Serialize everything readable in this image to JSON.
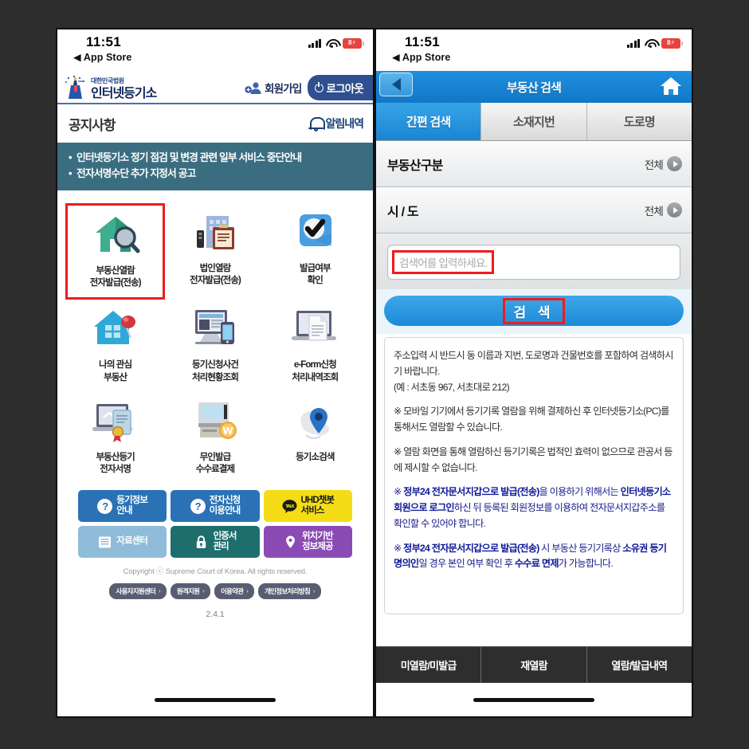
{
  "left_phone": {
    "status_bar": {
      "time": "11:51",
      "back_app": "App Store",
      "battery": "8"
    },
    "header": {
      "logo_small": "대한민국법원",
      "logo_big": "인터넷등기소",
      "join_label": "회원가입",
      "logout_label": "로그아웃"
    },
    "notice": {
      "title": "공지사항",
      "alarm_label": "알림내역",
      "items": [
        "인터넷등기소 정기 점검 및 변경 관련 일부 서비스 중단안내",
        "전자서명수단 추가 지정서 공고"
      ]
    },
    "menu_grid": [
      {
        "line1": "부동산열람",
        "line2": "전자발급(전송)",
        "icon": "house-magnifier-icon",
        "highlighted": true
      },
      {
        "line1": "법인열람",
        "line2": "전자발급(전송)",
        "icon": "building-clipboard-icon",
        "highlighted": false
      },
      {
        "line1": "발급여부",
        "line2": "확인",
        "icon": "checkmark-icon",
        "highlighted": false
      },
      {
        "line1": "나의 관심",
        "line2": "부동산",
        "icon": "house-pin-icon",
        "highlighted": false
      },
      {
        "line1": "등기신청사건",
        "line2": "처리현황조회",
        "icon": "monitor-mobile-icon",
        "highlighted": false
      },
      {
        "line1": "e-Form신청",
        "line2": "처리내역조회",
        "icon": "laptop-document-icon",
        "highlighted": false
      },
      {
        "line1": "부동산등기",
        "line2": "전자서명",
        "icon": "laptop-certificate-icon",
        "highlighted": false
      },
      {
        "line1": "무인발급",
        "line2": "수수료결제",
        "icon": "kiosk-won-icon",
        "highlighted": false
      },
      {
        "line1": "등기소검색",
        "line2": "",
        "icon": "map-pin-icon",
        "highlighted": false
      }
    ],
    "quick_buttons": [
      {
        "line1": "등기정보",
        "line2": "안내",
        "icon": "question-circle-icon",
        "color": "#2a72b5"
      },
      {
        "line1": "전자신청",
        "line2": "이용안내",
        "icon": "question-circle-icon",
        "color": "#2a72b5"
      },
      {
        "line1": "UHD챗봇",
        "line2": "서비스",
        "icon": "talk-bubble-icon",
        "color": "#f4dd16",
        "text_color": "#1a1a1a"
      },
      {
        "line1": "자료센터",
        "line2": "",
        "icon": "list-icon",
        "color": "#8fbcd8"
      },
      {
        "line1": "인증서",
        "line2": "관리",
        "icon": "lock-icon",
        "color": "#1e6e6e"
      },
      {
        "line1": "위치기반",
        "line2": "정보제공",
        "icon": "map-pin-icon",
        "color": "#8a4bb5"
      }
    ],
    "footer": {
      "copyright": "Copyright ⓒ Supreme Court of Korea. All rights reserved.",
      "links": [
        "사용자지원센터",
        "원격지원",
        "이용약관",
        "개인정보처리방침"
      ],
      "version": "2.4.1"
    }
  },
  "right_phone": {
    "status_bar": {
      "time": "11:51",
      "back_app": "App Store",
      "battery": "8"
    },
    "title_bar": {
      "title": "부동산 검색",
      "back_icon": "back-arrow-icon",
      "home_icon": "home-icon"
    },
    "tabs": [
      {
        "label": "간편 검색",
        "active": true
      },
      {
        "label": "소재지번",
        "active": false
      },
      {
        "label": "도로명",
        "active": false
      }
    ],
    "rows": [
      {
        "label": "부동산구분",
        "value": "전체"
      },
      {
        "label": "시 / 도",
        "value": "전체"
      }
    ],
    "search_input": {
      "placeholder": "검색어를 입력하세요.",
      "value": "",
      "highlighted": true
    },
    "search_button": {
      "label": "검 색",
      "highlighted": true
    },
    "info_paragraphs": [
      {
        "html": "주소입력 시 반드시 동 이름과 지번, 도로명과 건물번호를 포함하여 검색하시기 바랍니다.<br>(예 : 서초동 967, 서초대로 212)",
        "style": "plain"
      },
      {
        "html": "※ 모바일 기기에서 등기기록 열람을 위해 결제하신 후 인터넷등기소(PC)를 통해서도 열람할 수 있습니다.",
        "style": "plain"
      },
      {
        "html": "※ 열람 화면을 통해 열람하신 등기기록은 법적인 효력이 없으므로 관공서 등에 제시할 수 없습니다.",
        "style": "plain"
      },
      {
        "html": "※ <b>정부24 전자문서지갑으로 발급(전송)</b>을 이용하기 위해서는 <b>인터넷등기소 회원으로 로그인</b>하신 뒤 등록된 회원정보를 이용하여 전자문서지갑주소를 확인할 수 있어야 합니다.",
        "style": "blue"
      },
      {
        "html": "※ <b>정부24 전자문서지갑으로 발급(전송)</b> 시 부동산 등기기록상 <b>소유권 등기명의인</b>일 경우 본인 여부 확인 후 <b>수수료 면제</b>가 가능합니다.",
        "style": "blue"
      }
    ],
    "bottom_tabs": [
      "미열람/미발급",
      "재열람",
      "열람/발급내역"
    ]
  },
  "colors": {
    "background": "#2d2d2d",
    "notice_bar": "#3b6d80",
    "logout_pill": "#2f4f8f",
    "accent_blue": "#1c8ad8",
    "highlight_red": "#ee1c1c"
  }
}
